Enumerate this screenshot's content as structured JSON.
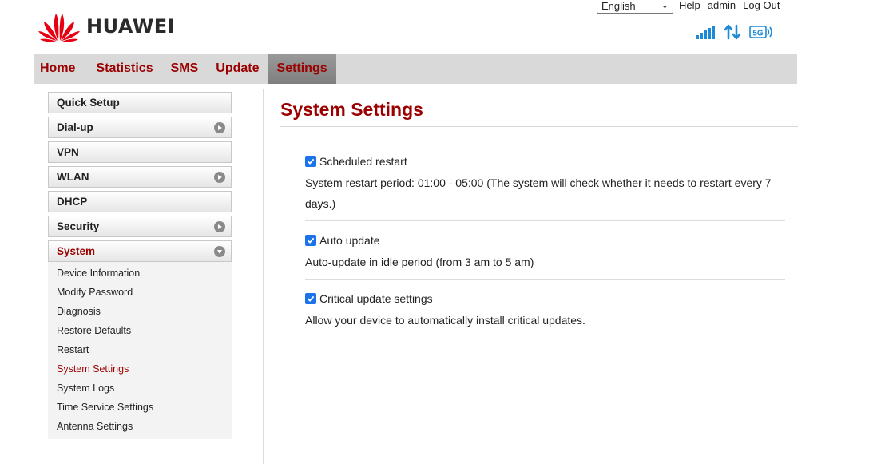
{
  "brand": {
    "name": "HUAWEI",
    "logo_icon": "huawei-petal-logo-icon",
    "logo_color": "#e60012"
  },
  "topbar": {
    "language": "English",
    "links": [
      "Help",
      "admin",
      "Log Out"
    ]
  },
  "status": {
    "signal_icon": "signal-strength-icon",
    "data_icon": "data-transfer-arrows-icon",
    "network_icon": "5g-network-icon",
    "network_label": "5G",
    "icon_color": "#1e8ad6"
  },
  "nav": {
    "items": [
      "Home",
      "Statistics",
      "SMS",
      "Update",
      "Settings"
    ],
    "active": "Settings",
    "accent": "#9b0000"
  },
  "sidebar": {
    "menus": [
      {
        "label": "Quick Setup",
        "expandable": false
      },
      {
        "label": "Dial-up",
        "expandable": true
      },
      {
        "label": "VPN",
        "expandable": false
      },
      {
        "label": "WLAN",
        "expandable": true
      },
      {
        "label": "DHCP",
        "expandable": false
      },
      {
        "label": "Security",
        "expandable": true
      },
      {
        "label": "System",
        "expandable": true,
        "open": true
      }
    ],
    "system_items": [
      "Device Information",
      "Modify Password",
      "Diagnosis",
      "Restore Defaults",
      "Restart",
      "System Settings",
      "System Logs",
      "Time Service Settings",
      "Antenna Settings"
    ],
    "active_item": "System Settings"
  },
  "main": {
    "title": "System Settings",
    "settings": [
      {
        "label": "Scheduled restart",
        "checked": true,
        "desc_line1": "System restart period:  01:00 - 05:00 (The system will check whether it needs to restart every 7",
        "desc_line2": "days.)"
      },
      {
        "label": "Auto update",
        "checked": true,
        "desc_line1": "Auto-update in idle period (from 3 am to 5 am)"
      },
      {
        "label": "Critical update settings",
        "checked": true,
        "desc_line1": "Allow your device to automatically install critical updates."
      }
    ]
  }
}
